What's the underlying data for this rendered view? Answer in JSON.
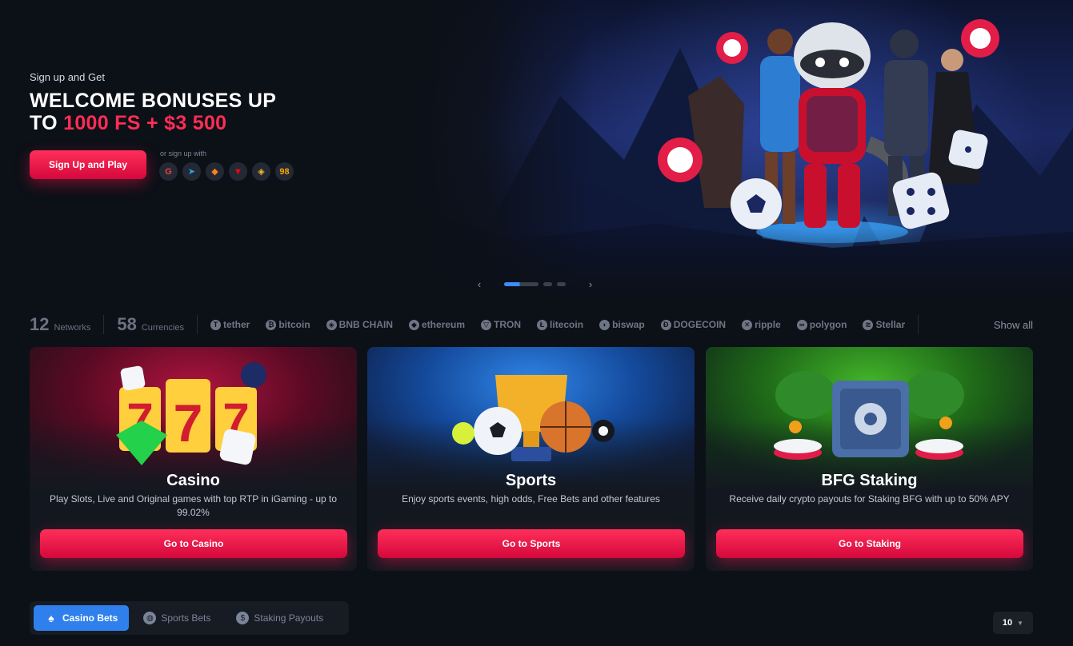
{
  "hero": {
    "kicker": "Sign up and Get",
    "headline_line1": "WELCOME BONUSES UP",
    "headline_to": "TO",
    "headline_accent": "1000 FS + $3 500",
    "signup_button": "Sign Up and Play",
    "alt_label": "or sign up with",
    "social": [
      {
        "icon": "google-icon",
        "glyph": "G",
        "color": "#ea4335"
      },
      {
        "icon": "telegram-icon",
        "glyph": "➤",
        "color": "#2aa3e0"
      },
      {
        "icon": "metamask-icon",
        "glyph": "◆",
        "color": "#f6851b"
      },
      {
        "icon": "tron-icon",
        "glyph": "▼",
        "color": "#ff0013"
      },
      {
        "icon": "binance-icon",
        "glyph": "◈",
        "color": "#f3ba2f"
      },
      {
        "icon": "bybit-icon",
        "glyph": "98",
        "color": "#f7a600"
      }
    ],
    "carousel": {
      "prev": "‹",
      "next": "›"
    }
  },
  "currency_bar": {
    "networks_count": "12",
    "networks_label": "Networks",
    "currencies_count": "58",
    "currencies_label": "Currencies",
    "coins": [
      {
        "name": "tether",
        "icon": "tether-icon",
        "sym": "T"
      },
      {
        "name": "bitcoin",
        "icon": "bitcoin-icon",
        "sym": "₿"
      },
      {
        "name": "BNB CHAIN",
        "icon": "bnb-icon",
        "sym": "◈"
      },
      {
        "name": "ethereum",
        "icon": "ethereum-icon",
        "sym": "◆"
      },
      {
        "name": "TRON",
        "icon": "tron-icon",
        "sym": "▽"
      },
      {
        "name": "litecoin",
        "icon": "litecoin-icon",
        "sym": "Ł"
      },
      {
        "name": "biswap",
        "icon": "biswap-icon",
        "sym": "◗"
      },
      {
        "name": "DOGECOIN",
        "icon": "dogecoin-icon",
        "sym": "Ð"
      },
      {
        "name": "ripple",
        "icon": "ripple-icon",
        "sym": "✕"
      },
      {
        "name": "polygon",
        "icon": "polygon-icon",
        "sym": "∞"
      },
      {
        "name": "Stellar",
        "icon": "stellar-icon",
        "sym": "≋"
      }
    ],
    "show_all": "Show all"
  },
  "cards": [
    {
      "title": "Casino",
      "desc": "Play Slots, Live and Original games with top RTP in iGaming - up to 99.02%",
      "button": "Go to Casino",
      "color": "#7a1030"
    },
    {
      "title": "Sports",
      "desc": "Enjoy sports events, high odds, Free Bets and other features",
      "button": "Go to Sports",
      "color": "#145bb8"
    },
    {
      "title": "BFG Staking",
      "desc": "Receive daily crypto payouts for Staking BFG with up to 50% APY",
      "button": "Go to Staking",
      "color": "#2e8a1e"
    }
  ],
  "bets_tabs": [
    {
      "label": "Casino Bets",
      "icon": "spade-icon",
      "glyph": "♠"
    },
    {
      "label": "Sports Bets",
      "icon": "basketball-icon",
      "glyph": "◍"
    },
    {
      "label": "Staking Payouts",
      "icon": "dollar-icon",
      "glyph": "$"
    }
  ],
  "rows_select": {
    "value": "10"
  }
}
